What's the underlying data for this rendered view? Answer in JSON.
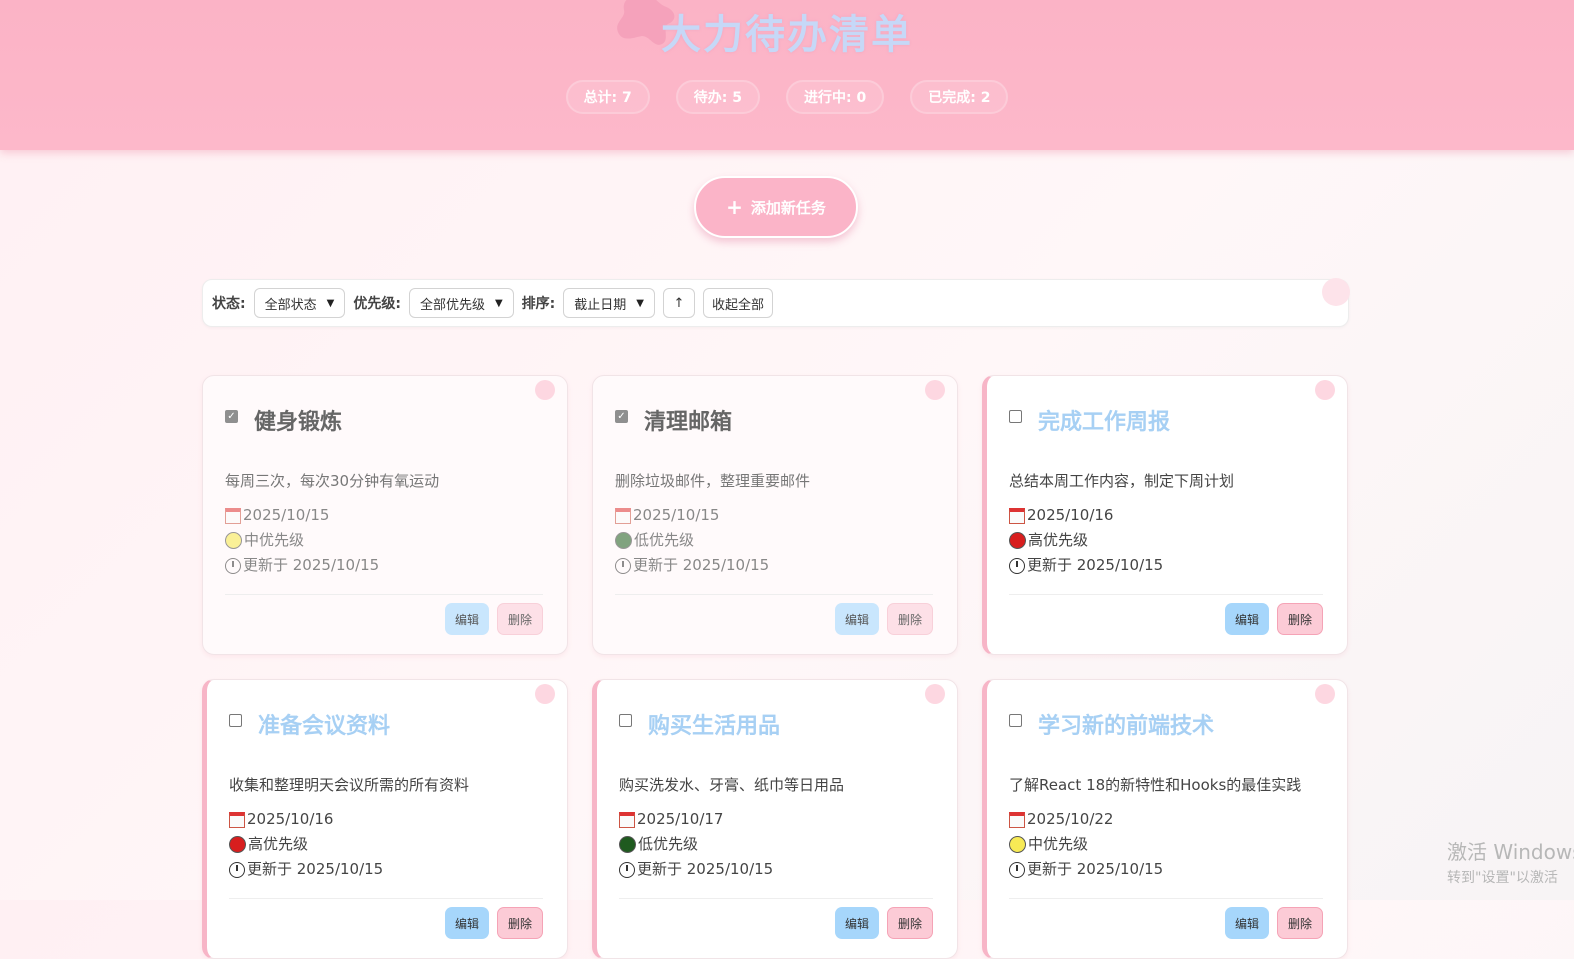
{
  "header": {
    "title": "大力待办清单",
    "stats": [
      {
        "label": "总计: 7"
      },
      {
        "label": "待办: 5"
      },
      {
        "label": "进行中: 0"
      },
      {
        "label": "已完成: 2"
      }
    ]
  },
  "add_button": {
    "icon": "+",
    "label": "添加新任务"
  },
  "filters": {
    "status_label": "状态:",
    "status_value": "全部状态",
    "priority_label": "优先级:",
    "priority_value": "全部优先级",
    "sort_label": "排序:",
    "sort_value": "截止日期",
    "sort_direction": "↑",
    "collapse_label": "收起全部"
  },
  "tasks": [
    {
      "title": "健身锻炼",
      "desc": "每周三次，每次30分钟有氧运动",
      "date": "2025/10/15",
      "priority": "中优先级",
      "priority_color": "#f7ea55",
      "updated": "更新于 2025/10/15",
      "done": true
    },
    {
      "title": "清理邮箱",
      "desc": "删除垃圾邮件，整理重要邮件",
      "date": "2025/10/15",
      "priority": "低优先级",
      "priority_color": "#2e6b2e",
      "updated": "更新于 2025/10/15",
      "done": true
    },
    {
      "title": "完成工作周报",
      "desc": "总结本周工作内容，制定下周计划",
      "date": "2025/10/16",
      "priority": "高优先级",
      "priority_color": "#d81e1e",
      "updated": "更新于 2025/10/15",
      "done": false
    },
    {
      "title": "准备会议资料",
      "desc": "收集和整理明天会议所需的所有资料",
      "date": "2025/10/16",
      "priority": "高优先级",
      "priority_color": "#d81e1e",
      "updated": "更新于 2025/10/15",
      "done": false
    },
    {
      "title": "购买生活用品",
      "desc": "购买洗发水、牙膏、纸巾等日用品",
      "date": "2025/10/17",
      "priority": "低优先级",
      "priority_color": "#1f5a1f",
      "updated": "更新于 2025/10/15",
      "done": false
    },
    {
      "title": "学习新的前端技术",
      "desc": "了解React 18的新特性和Hooks的最佳实践",
      "date": "2025/10/22",
      "priority": "中优先级",
      "priority_color": "#f7ea55",
      "updated": "更新于 2025/10/15",
      "done": false
    }
  ],
  "card_actions": {
    "edit_label": "编辑",
    "delete_label": "删除"
  },
  "watermark": {
    "line1": "激活 Windows",
    "line2": "转到\"设置\"以激活"
  },
  "colors": {
    "header_pink": "#fbb3c6",
    "title_blue": "#a7d0f4",
    "edit_blue": "#a6d6fb",
    "delete_pink": "#fccbd6"
  }
}
